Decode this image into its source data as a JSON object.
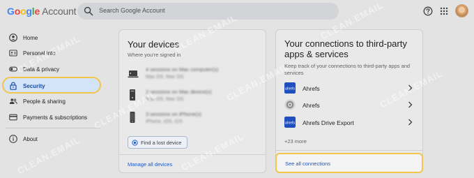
{
  "header": {
    "logo_google": "Google",
    "logo_account": "Account",
    "search_placeholder": "Search Google Account"
  },
  "colors": {
    "google_blue": "#4285f4",
    "google_red": "#ea4335",
    "google_yellow": "#fbbc05",
    "google_green": "#34a853",
    "highlight": "#f3c54a",
    "link": "#1a57c5",
    "active_nav": "#d3e3f8"
  },
  "nav": {
    "items": [
      {
        "label": "Home",
        "icon": "account-circle-icon"
      },
      {
        "label": "Personal info",
        "icon": "id-card-icon"
      },
      {
        "label": "Data & privacy",
        "icon": "toggle-icon"
      },
      {
        "label": "Security",
        "icon": "lock-icon",
        "active": true
      },
      {
        "label": "People & sharing",
        "icon": "people-icon"
      },
      {
        "label": "Payments & subscriptions",
        "icon": "credit-card-icon"
      },
      {
        "label": "About",
        "icon": "info-icon"
      }
    ]
  },
  "devices": {
    "title": "Your devices",
    "subtitle": "Where you're signed in",
    "rows": [
      {
        "name": "4 sessions on Mac computer(s)",
        "detail": "Mac OS, Mac OS",
        "icon": "laptop-icon"
      },
      {
        "name": "2 sessions on Mac device(s)",
        "detail": "Mac OS, Mac OS",
        "icon": "desktop-icon"
      },
      {
        "name": "3 sessions on iPhone(s)",
        "detail": "iPhone, iOS, iOS",
        "icon": "phone-icon"
      }
    ],
    "find_button": "Find a lost device",
    "manage_link": "Manage all devices"
  },
  "connections": {
    "title_line1": "Your connections to third-party",
    "title_line2": "apps & services",
    "subtitle_line1": "Keep track of your connections to third-party apps and",
    "subtitle_line2": "services",
    "rows": [
      {
        "label": "Ahrefs",
        "icon": "ahrefs-logo-icon"
      },
      {
        "label": "Ahrefs",
        "icon": "ahrefs-gray-logo-icon"
      },
      {
        "label": "Ahrefs Drive Export",
        "icon": "ahrefs-drive-logo-icon"
      }
    ],
    "more": "+23 more",
    "see_all": "See all connections"
  },
  "watermark": "CLEAN.EMAIL"
}
